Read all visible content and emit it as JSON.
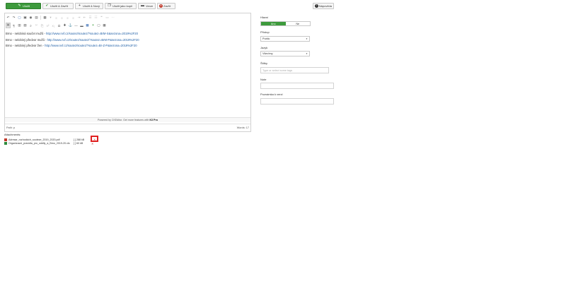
{
  "toolbar": {
    "save": "Uložit",
    "save_close": "Uložit & Zavřít",
    "save_new": "Uložit & Nový",
    "save_copy": "Uložit jako kopii",
    "versions": "Verze",
    "close": "Zavřít",
    "help": "Nápověda"
  },
  "editor": {
    "lines": [
      {
        "text": "Brno - nelobiná součet mužů - ",
        "link": "http://www.nvf.cz/soutez/soutez/?soutez=BrM-S&sezona=2019%2F20"
      },
      {
        "text": "Brno - nelobiný předvor mužů - ",
        "link": "http://www.nvf.cz/soutez/soutez/?soutez=BrM-P&sezona=2019%2F20"
      },
      {
        "text": "Brno - nelobiný předvor žen - ",
        "link": "http://www.nvf.cz/soutez/soutez/?soutez=Br-Z-P&sezona=2019%2F20"
      }
    ],
    "powered_prefix": "Powered by CKEditor. Get more features with ",
    "powered_brand": "K3 Pro",
    "path_label": "Path: p",
    "words_label": "Words: 17"
  },
  "attachments": {
    "title": "Attachments:",
    "items": [
      {
        "name": "Adresar_rozhodcich_souteze_2019_2020.pdf",
        "size": "[ ] 288 kB"
      },
      {
        "name": "Organizacni_pravidla_pro_oddily_a_Brno_2019-20.xls",
        "size": "[ ] 60 kB"
      }
    ],
    "delete_glyph": "✕"
  },
  "sidebar": {
    "status_label": "Hlavní",
    "yes": "Ano",
    "no": "Ne",
    "access_label": "Přístup",
    "access_value": "Public",
    "lang_label": "Jazyk",
    "lang_value": "Všechny",
    "tags_label": "Štítky",
    "tags_placeholder": "Type or select some tags",
    "note_label": "Note",
    "version_note_label": "Poznámka k verzi"
  },
  "colors": {
    "primary": "#3d9a3c",
    "link": "#1f5fa6",
    "highlight": "#e02020"
  }
}
